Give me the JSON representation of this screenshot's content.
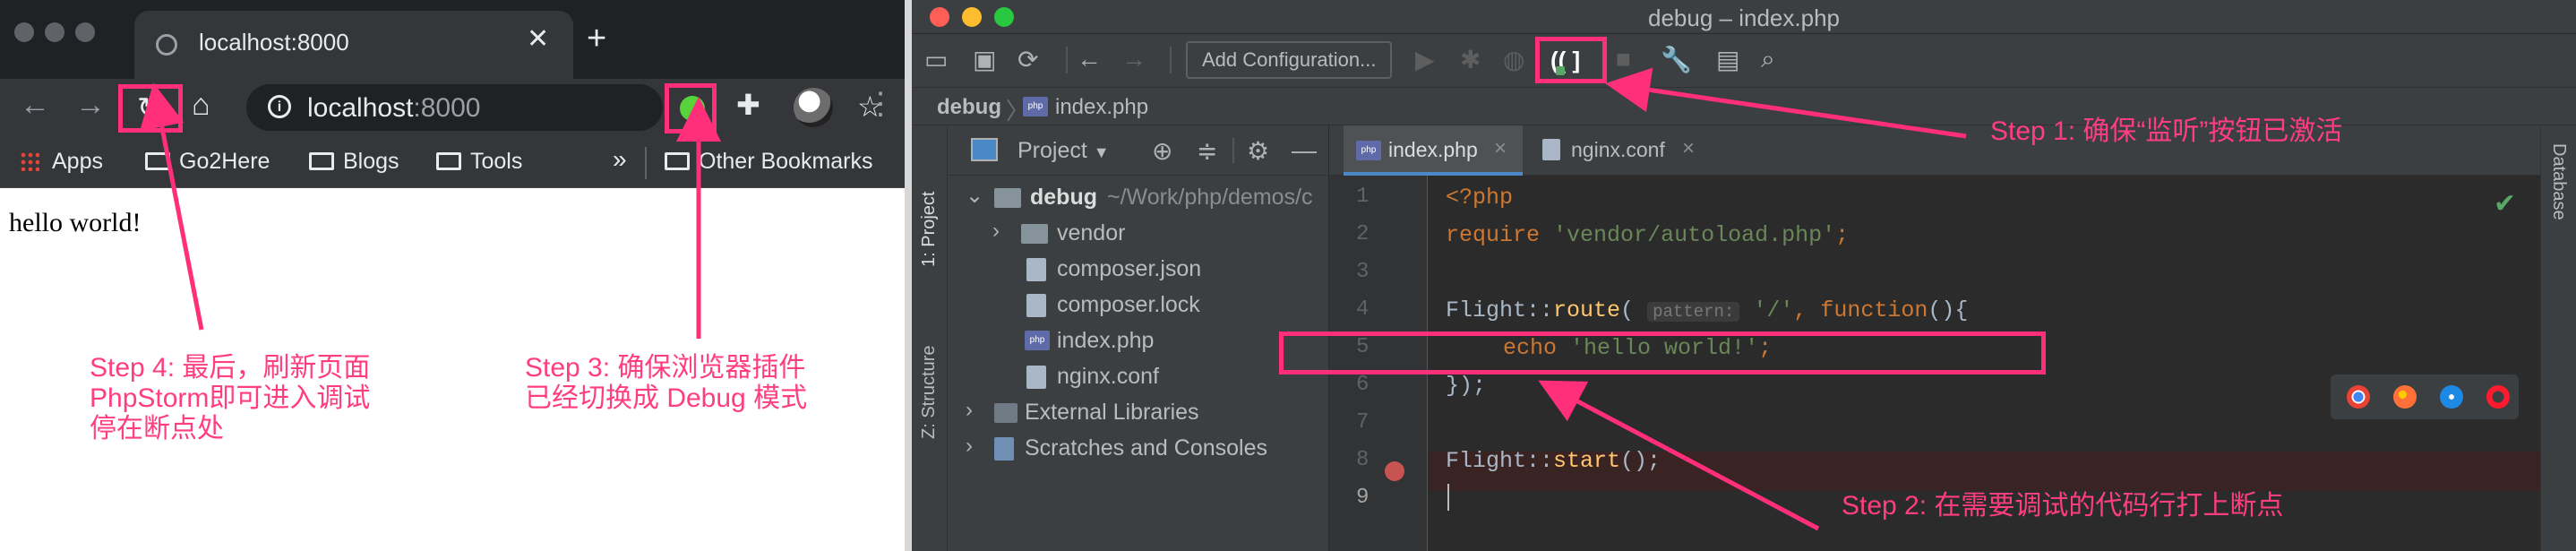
{
  "browser": {
    "tab_title": "localhost:8000",
    "address_host": "localhost",
    "address_port": ":8000",
    "bookmarks": [
      {
        "label": "Apps",
        "icon": "apps-grid-icon"
      },
      {
        "label": "Go2Here",
        "icon": "folder-icon"
      },
      {
        "label": "Blogs",
        "icon": "folder-icon"
      },
      {
        "label": "Tools",
        "icon": "folder-icon"
      }
    ],
    "overflow": "»",
    "other_bookmarks": "Other Bookmarks",
    "page_text": "hello world!"
  },
  "ide": {
    "window_title": "debug – index.php",
    "add_configuration": "Add Configuration...",
    "breadcrumb_project": "debug",
    "breadcrumb_file": "index.php",
    "left_tabs": [
      "1: Project",
      "Z: Structure"
    ],
    "right_tab": "Database",
    "panel_title": "Project",
    "tree": [
      {
        "label": "debug",
        "path": "~/Work/php/demos/c",
        "type": "root"
      },
      {
        "label": "vendor",
        "type": "folder"
      },
      {
        "label": "composer.json",
        "type": "file"
      },
      {
        "label": "composer.lock",
        "type": "file"
      },
      {
        "label": "index.php",
        "type": "php"
      },
      {
        "label": "nginx.conf",
        "type": "file"
      },
      {
        "label": "External Libraries",
        "type": "lib"
      },
      {
        "label": "Scratches and Consoles",
        "type": "scratch"
      }
    ],
    "editor_tabs": [
      "index.php",
      "nginx.conf"
    ],
    "line_numbers": [
      "1",
      "2",
      "3",
      "4",
      "5",
      "6",
      "7",
      "8",
      "9"
    ],
    "code": {
      "l1": "<?php",
      "l2_kw": "require",
      "l2_str": "'vendor/autoload.php'",
      "l2_end": ";",
      "l4_cls": "Flight::",
      "l4_fn": "route",
      "l4_open": "(",
      "l4_hint": "pattern:",
      "l4_str": "'/'",
      "l4_comma": ", ",
      "l4_kw": "function",
      "l4_end": "(){",
      "l5_kw": "echo",
      "l5_str": "'hello world!'",
      "l5_end": ";",
      "l6": "});",
      "l8_cls": "Flight::",
      "l8_fn": "start",
      "l8_end": "();"
    }
  },
  "annotations": {
    "step1": "Step 1: 确保“监听”按钮已激活",
    "step2": "Step 2: 在需要调试的代码行打上断点",
    "step3_l1": "Step 3: 确保浏览器插件",
    "step3_l2": "已经切换成 Debug 模式",
    "step4_l1": "Step 4: 最后，刷新页面",
    "step4_l2": "PhpStorm即可进入调试",
    "step4_l3": "停在断点处"
  },
  "colors": {
    "annotation": "#ff2f7a",
    "chrome_dark": "#202124",
    "ide_bg": "#2b2b2b",
    "keyword": "#cc7832",
    "string": "#6a8759"
  }
}
